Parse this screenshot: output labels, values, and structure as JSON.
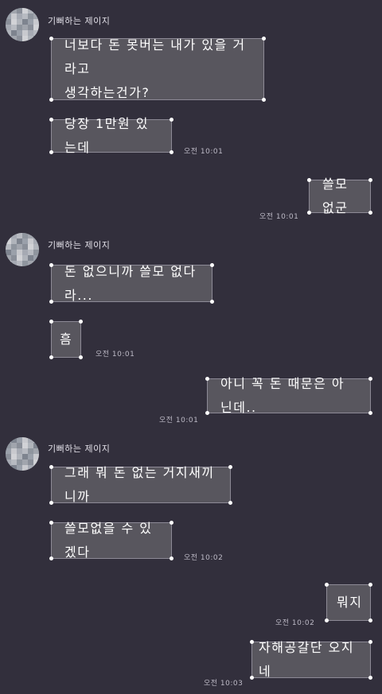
{
  "sender_name": "기뻐하는 제이지",
  "messages": [
    {
      "from": "them",
      "text": "너보다 돈 못버는 내가 있을 거라고\n생각하는건가?",
      "time": ""
    },
    {
      "from": "them",
      "text": "당장 1만원 있는데",
      "time": "오전 10:01"
    },
    {
      "from": "me",
      "text": "쓸모없군",
      "time": "오전 10:01"
    },
    {
      "from": "them",
      "text": "돈 없으니까 쓸모 없다라...",
      "time": ""
    },
    {
      "from": "them",
      "text": "흠",
      "time": "오전 10:01"
    },
    {
      "from": "me",
      "text": "아니 꼭 돈 때문은 아닌데..",
      "time": "오전 10:01"
    },
    {
      "from": "them",
      "text": "그래 뭐 돈 없는 거지새끼니까",
      "time": ""
    },
    {
      "from": "them",
      "text": "쓸모없을 수 있겠다",
      "time": "오전 10:02"
    },
    {
      "from": "me",
      "text": "뭐지",
      "time": "오전 10:02"
    },
    {
      "from": "me",
      "text": "자해공갈단 오지네",
      "time": "오전 10:03"
    }
  ],
  "colors": {
    "background": "#322f3c",
    "bubble": "#58565e",
    "bubble_border": "#8d8a96",
    "corner_dot": "#ffffff"
  }
}
